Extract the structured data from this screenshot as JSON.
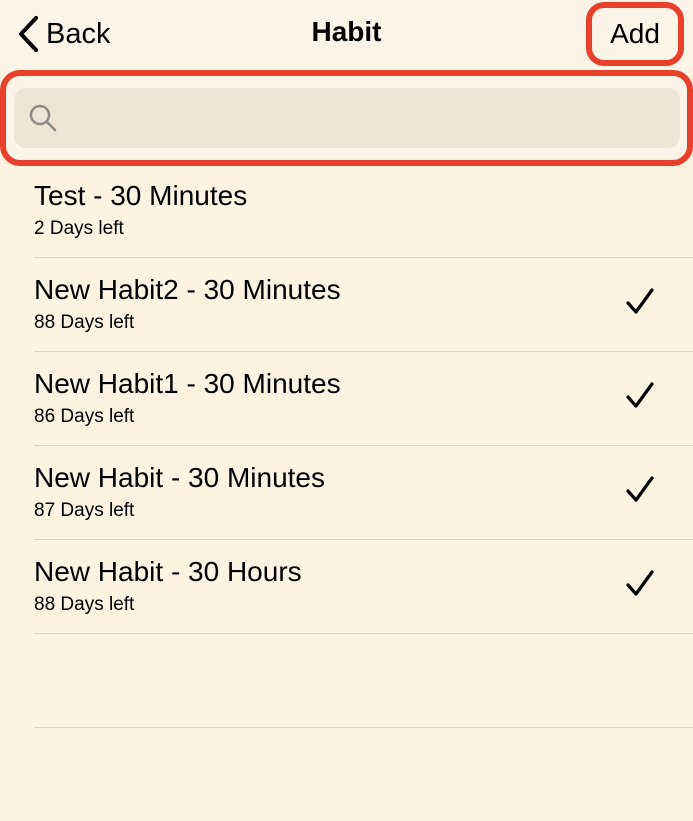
{
  "nav": {
    "back_label": "Back",
    "title": "Habit",
    "add_label": "Add"
  },
  "search": {
    "placeholder": "",
    "value": ""
  },
  "habits": [
    {
      "title": "Test - 30 Minutes",
      "subtitle": "2 Days left",
      "checked": false
    },
    {
      "title": "New Habit2 - 30 Minutes",
      "subtitle": "88 Days left",
      "checked": true
    },
    {
      "title": "New Habit1 - 30 Minutes",
      "subtitle": "86 Days left",
      "checked": true
    },
    {
      "title": "New Habit - 30 Minutes",
      "subtitle": "87 Days left",
      "checked": true
    },
    {
      "title": "New Habit - 30 Hours",
      "subtitle": "88 Days left",
      "checked": true
    }
  ],
  "icons": {
    "back": "chevron-left-icon",
    "search": "magnifier-icon",
    "check": "checkmark-icon"
  },
  "colors": {
    "background": "#fdf3e0",
    "highlight": "#e8412b",
    "search_field": "#eee5d5"
  }
}
